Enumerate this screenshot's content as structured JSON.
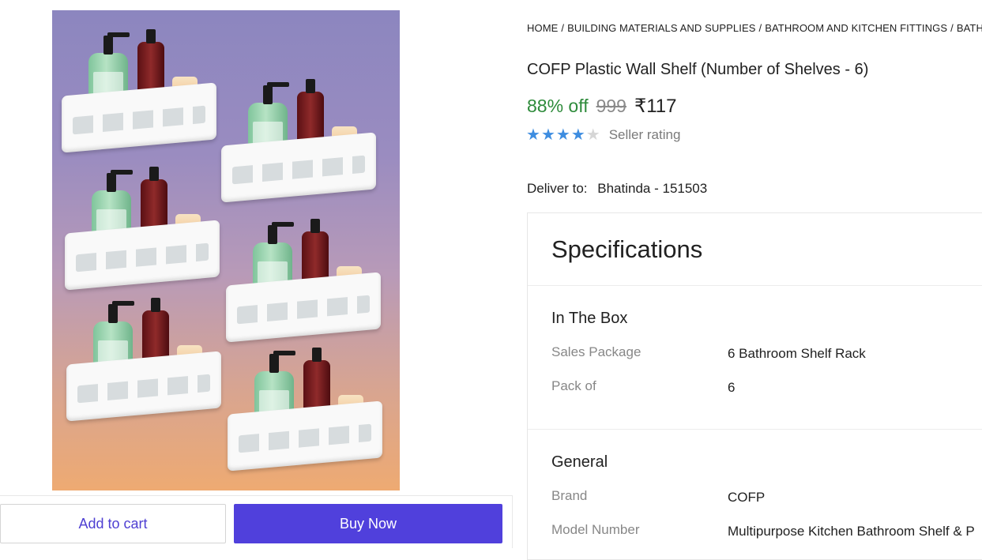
{
  "breadcrumb": [
    "HOME",
    "BUILDING MATERIALS AND SUPPLIES",
    "BATHROOM AND KITCHEN FITTINGS",
    "BATHROO"
  ],
  "product": {
    "title": "COFP Plastic Wall Shelf (Number of Shelves - 6)",
    "discount": "88% off",
    "mrp": "999",
    "price": "₹117",
    "rating_stars": 4,
    "rating_max": 5,
    "rating_label": "Seller rating",
    "star_glyph": "★"
  },
  "delivery": {
    "label": "Deliver to:",
    "location": "Bhatinda - 151503"
  },
  "specifications": {
    "title": "Specifications",
    "sections": [
      {
        "title": "In The Box",
        "rows": [
          {
            "key": "Sales Package",
            "value": "6 Bathroom Shelf Rack"
          },
          {
            "key": "Pack of",
            "value": "6"
          }
        ]
      },
      {
        "title": "General",
        "rows": [
          {
            "key": "Brand",
            "value": "COFP"
          },
          {
            "key": "Model Number",
            "value": "Multipurpose Kitchen Bathroom Shelf & P"
          }
        ]
      }
    ]
  },
  "actions": {
    "add_to_cart": "Add to cart",
    "buy_now": "Buy Now"
  },
  "image": {
    "shelf_count": 6
  },
  "colors": {
    "discount_green": "#2e8b3b",
    "star_blue": "#3e8de0",
    "buy_button": "#5040dc",
    "cart_text": "#4e3fd2"
  }
}
